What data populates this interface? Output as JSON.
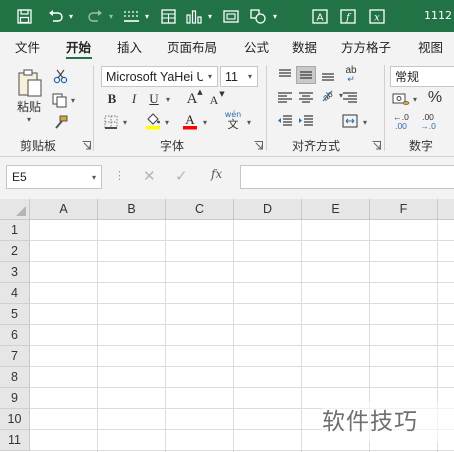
{
  "title_bar": {
    "bg_color": "#217346",
    "title_text": "1112",
    "qat_icons": [
      "save-icon",
      "undo-icon",
      "redo-icon",
      "format-painter-icon",
      "form-icon",
      "chart-icon",
      "camera-icon",
      "shapes-icon",
      "textbox-icon",
      "formula-icon",
      "function-icon"
    ]
  },
  "tabs": [
    {
      "label": "文件",
      "active": false
    },
    {
      "label": "开始",
      "active": true
    },
    {
      "label": "插入",
      "active": false
    },
    {
      "label": "页面布局",
      "active": false
    },
    {
      "label": "公式",
      "active": false
    },
    {
      "label": "数据",
      "active": false
    },
    {
      "label": "方方格子",
      "active": false
    },
    {
      "label": "视图",
      "active": false
    }
  ],
  "ribbon": {
    "clipboard": {
      "group_label": "剪贴板",
      "paste_label": "粘贴"
    },
    "font": {
      "group_label": "字体",
      "font_name": "Microsoft YaHei UI",
      "font_size": "11",
      "bold": "B",
      "italic": "I",
      "underline": "U",
      "grow": "A",
      "shrink": "A",
      "phonetic": "wén",
      "fill_color": "#ffff00",
      "font_color": "#ff0000"
    },
    "alignment": {
      "group_label": "对齐方式",
      "wrap_label": "ab"
    },
    "number": {
      "group_label": "数字",
      "format": "常规",
      "percent": "%",
      "inc_decimal": "←.0",
      "dec_decimal": ".00"
    }
  },
  "formula_bar": {
    "name_box": "E5",
    "fx_label": "fx",
    "formula": ""
  },
  "grid": {
    "columns": [
      "A",
      "B",
      "C",
      "D",
      "E",
      "F"
    ],
    "rows": [
      "1",
      "2",
      "3",
      "4",
      "5",
      "6",
      "7",
      "8",
      "9",
      "10",
      "11"
    ]
  },
  "watermark": "软件技巧"
}
